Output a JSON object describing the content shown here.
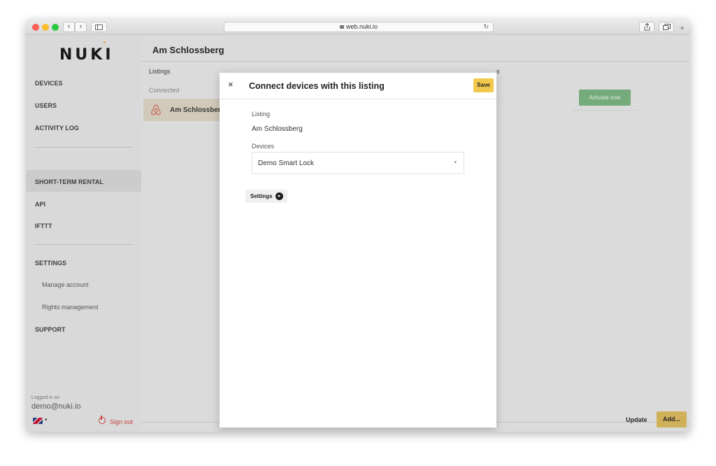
{
  "browser": {
    "url": "web.nuki.io",
    "nav_back": "‹",
    "nav_forward": "›",
    "new_tab": "+"
  },
  "sidebar": {
    "logo": "NUKI",
    "items": [
      {
        "label": "DEVICES"
      },
      {
        "label": "USERS"
      },
      {
        "label": "ACTIVITY LOG"
      },
      {
        "label": "SHORT-TERM RENTAL",
        "active": true
      },
      {
        "label": "API"
      },
      {
        "label": "IFTTT"
      },
      {
        "label": "SETTINGS"
      },
      {
        "label": "Manage account",
        "sub": true
      },
      {
        "label": "Rights management",
        "sub": true
      },
      {
        "label": "SUPPORT"
      }
    ],
    "logged_in_label": "Logged in as",
    "email": "demo@nuki.io",
    "sign_out": "Sign out",
    "language_icon": "uk-flag-icon",
    "language_caret": "▾"
  },
  "main": {
    "title": "Am Schlossberg",
    "tab_listings": "Listings",
    "tab_right_fragment": "s",
    "section_connected": "Connected",
    "listing_name": "Am Schlossberg",
    "listing_icon": "airbnb-icon",
    "activate_button": "Activate now",
    "update_button": "Update",
    "add_button": "Add...",
    "accent_color": "#f2c94c",
    "activate_color": "#76b07c"
  },
  "modal": {
    "close": "×",
    "title": "Connect devices with this listing",
    "save": "Save",
    "listing_label": "Listing",
    "listing_value": "Am Schlossberg",
    "devices_label": "Devices",
    "devices_value": "Demo Smart Lock",
    "devices_caret": "▾",
    "settings_label": "Settings"
  }
}
